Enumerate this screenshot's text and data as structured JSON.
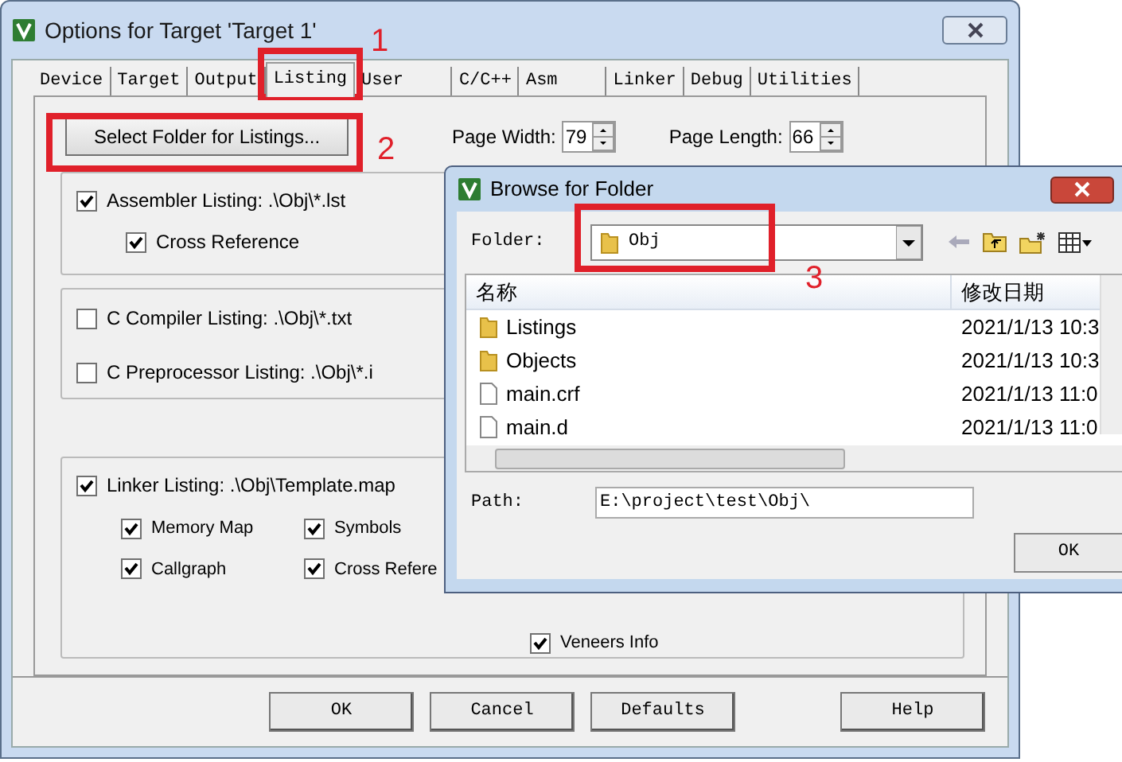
{
  "window": {
    "title": "Options for Target 'Target 1'"
  },
  "tabs": [
    {
      "label": "Device",
      "selected": false
    },
    {
      "label": "Target",
      "selected": false
    },
    {
      "label": "Output",
      "selected": false
    },
    {
      "label": "Listing",
      "selected": true
    },
    {
      "label": "User",
      "selected": false
    },
    {
      "label": "C/C++",
      "selected": false
    },
    {
      "label": "Asm",
      "selected": false
    },
    {
      "label": "Linker",
      "selected": false
    },
    {
      "label": "Debug",
      "selected": false
    },
    {
      "label": "Utilities",
      "selected": false
    }
  ],
  "select_folder_button": "Select Folder for Listings...",
  "page_width": {
    "label": "Page Width:",
    "value": "79"
  },
  "page_length": {
    "label": "Page Length:",
    "value": "66"
  },
  "groups": [
    {
      "options": [
        {
          "label": "Assembler Listing:  .\\Obj\\*.lst",
          "checked": true,
          "children": [
            {
              "label": "Cross Reference",
              "checked": true
            }
          ]
        }
      ]
    },
    {
      "options": [
        {
          "label": "C Compiler Listing:  .\\Obj\\*.txt",
          "checked": false
        },
        {
          "label": "C Preprocessor Listing:  .\\Obj\\*.i",
          "checked": false
        }
      ]
    },
    {
      "options": [
        {
          "label": "Linker Listing:  .\\Obj\\Template.map",
          "checked": true,
          "children": [
            {
              "label": "Memory Map",
              "checked": true
            },
            {
              "label": "Symbols",
              "checked": true
            },
            {
              "label": "Callgraph",
              "checked": true
            },
            {
              "label": "Cross Refere",
              "checked": true
            },
            {
              "label": "Veneers Info",
              "checked": true
            }
          ]
        }
      ]
    }
  ],
  "buttons": [
    "OK",
    "Cancel",
    "Defaults",
    "Help"
  ],
  "browse_dialog": {
    "title": "Browse for Folder",
    "folder_label": "Folder:",
    "folder_value": "Obj",
    "columns": [
      "名称",
      "修改日期"
    ],
    "rows": [
      {
        "kind": "folder",
        "name": "Listings",
        "date": "2021/1/13 10:3"
      },
      {
        "kind": "folder",
        "name": "Objects",
        "date": "2021/1/13 10:3"
      },
      {
        "kind": "file",
        "name": "main.crf",
        "date": "2021/1/13 11:0"
      },
      {
        "kind": "file",
        "name": "main.d",
        "date": "2021/1/13 11:0"
      }
    ],
    "path_label": "Path:",
    "path_value": "E:\\project\\test\\Obj\\",
    "ok_button": "OK"
  },
  "annotations": [
    {
      "label": "1"
    },
    {
      "label": "2"
    },
    {
      "label": "3"
    }
  ]
}
